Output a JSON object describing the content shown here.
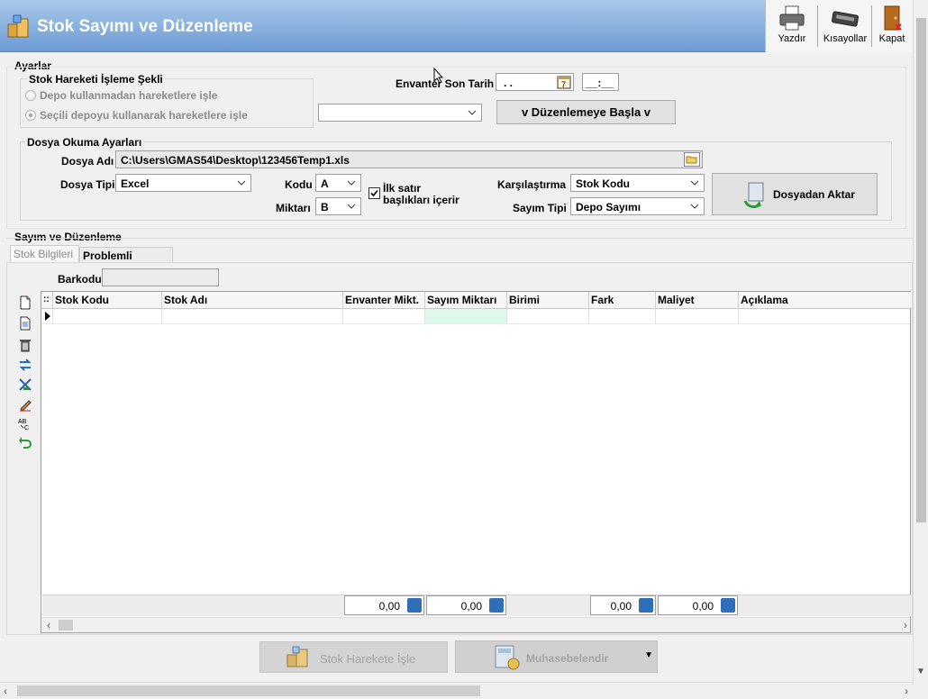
{
  "window": {
    "title": "Stok Sayımı ve Düzenleme"
  },
  "toolbar": {
    "print": "Yazdır",
    "shortcuts": "Kısayollar",
    "close": "Kapat"
  },
  "settings": {
    "group_label": "Ayarlar",
    "movement_mode_label": "Stok Hareketi İşleme Şekli",
    "radio_no_depot": "Depo kullanmadan hareketlere işle",
    "radio_selected_depot": "Seçili depoyu kullanarak hareketlere işle",
    "inventory_last_date_label": "Envanter Son Tarih",
    "date_value": ". .",
    "time_value": "__:__",
    "depot_select_value": "",
    "start_button": "v Düzenlemeye Başla v"
  },
  "file_settings": {
    "group_label": "Dosya Okuma Ayarları",
    "file_name_label": "Dosya Adı",
    "file_name_value": "C:\\Users\\GMAS54\\Desktop\\123456Temp1.xls",
    "file_type_label": "Dosya Tipi",
    "file_type_value": "Excel",
    "code_label": "Kodu",
    "code_value": "A",
    "quantity_label": "Miktarı",
    "quantity_value": "B",
    "first_row_headers_line1": "İlk satır",
    "first_row_headers_line2": "başlıkları içerir",
    "first_row_headers_checked": true,
    "compare_label": "Karşılaştırma",
    "compare_value": "Stok Kodu",
    "count_type_label": "Sayım Tipi",
    "count_type_value": "Depo Sayımı",
    "import_button": "Dosyadan Aktar"
  },
  "count_section": {
    "group_label": "Sayım ve Düzenleme",
    "tabs": [
      "Stok Bilgileri",
      "Problemli Stoklar"
    ],
    "barcode_label": "Barkodu",
    "barcode_value": ""
  },
  "grid": {
    "row_indicator_header": "::",
    "columns": [
      "Stok Kodu",
      "Stok Adı",
      "Envanter Mikt.",
      "Sayım Miktarı",
      "Birimi",
      "Fark",
      "Maliyet",
      "Açıklama"
    ],
    "totals": [
      "0,00",
      "0,00",
      "0,00",
      "0,00"
    ]
  },
  "bottom": {
    "post_button": "Stok Harekete İşle",
    "accounting_button": "Muhasebelendir"
  },
  "colors": {
    "header_start": "#a9c8ea",
    "header_end": "#6d9bd3",
    "sayim_cell": "#dff8ec"
  }
}
